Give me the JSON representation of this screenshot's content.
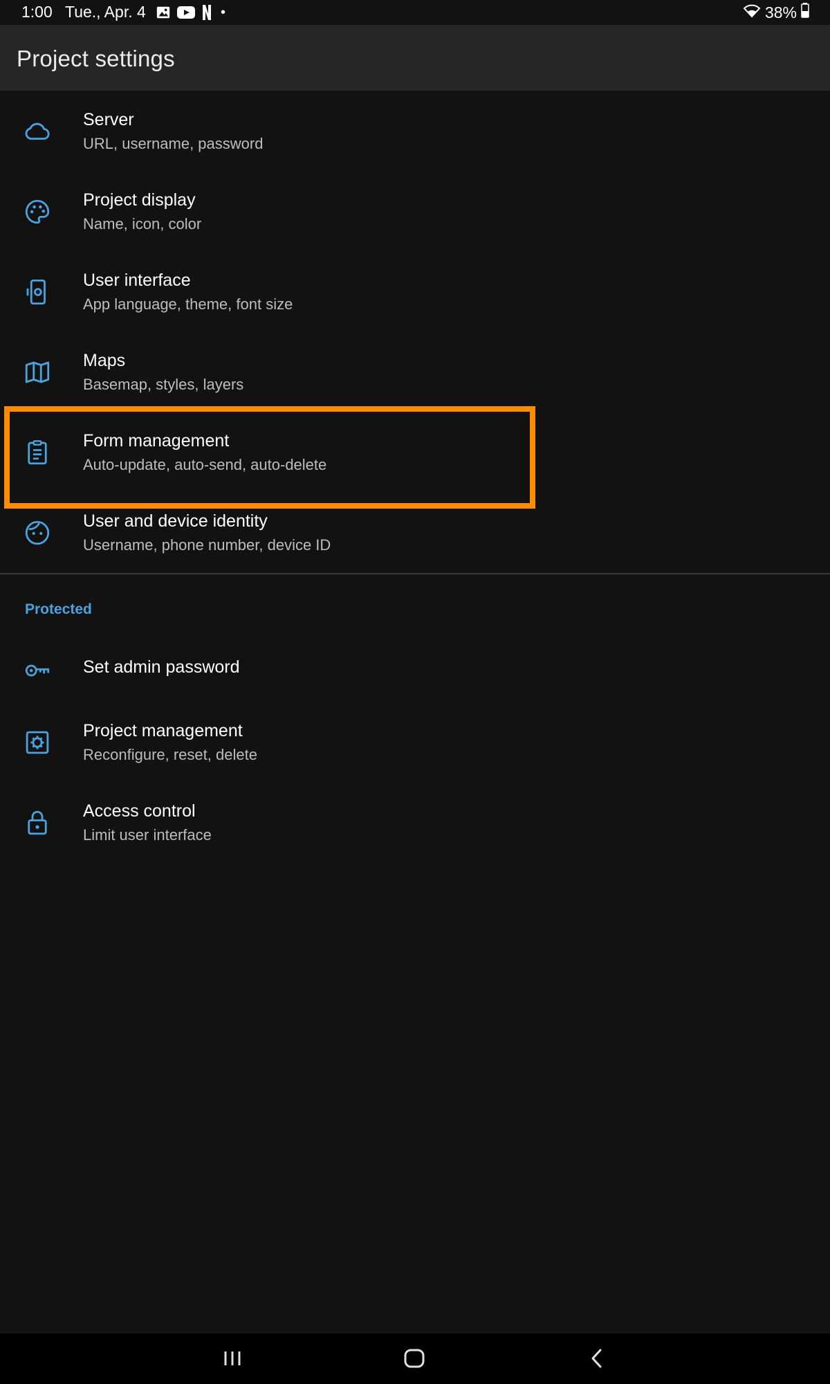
{
  "status_bar": {
    "time": "1:00",
    "date": "Tue., Apr. 4",
    "battery": "38%",
    "notification_icons": [
      "gallery-icon",
      "youtube-icon",
      "netflix-icon"
    ]
  },
  "app_bar": {
    "title": "Project settings"
  },
  "settings": [
    {
      "id": "server",
      "title": "Server",
      "subtitle": "URL, username, password",
      "icon": "cloud-icon"
    },
    {
      "id": "project-display",
      "title": "Project display",
      "subtitle": "Name, icon, color",
      "icon": "palette-icon"
    },
    {
      "id": "user-interface",
      "title": "User interface",
      "subtitle": "App language, theme, font size",
      "icon": "phone-settings-icon"
    },
    {
      "id": "maps",
      "title": "Maps",
      "subtitle": "Basemap, styles, layers",
      "icon": "map-icon"
    },
    {
      "id": "form-management",
      "title": "Form management",
      "subtitle": "Auto-update, auto-send, auto-delete",
      "icon": "clipboard-icon",
      "highlighted": true
    },
    {
      "id": "user-device-identity",
      "title": "User and device identity",
      "subtitle": "Username, phone number, device ID",
      "icon": "face-icon"
    }
  ],
  "protected_section": {
    "header": "Protected",
    "items": [
      {
        "id": "admin-password",
        "title": "Set admin password",
        "icon": "key-icon"
      },
      {
        "id": "project-management",
        "title": "Project management",
        "subtitle": "Reconfigure, reset, delete",
        "icon": "settings-box-icon"
      },
      {
        "id": "access-control",
        "title": "Access control",
        "subtitle": "Limit user interface",
        "icon": "lock-icon"
      }
    ]
  },
  "colors": {
    "accent": "#4aa3df",
    "highlight": "#ff8c00",
    "background": "#121212",
    "app_bar": "#262626"
  }
}
